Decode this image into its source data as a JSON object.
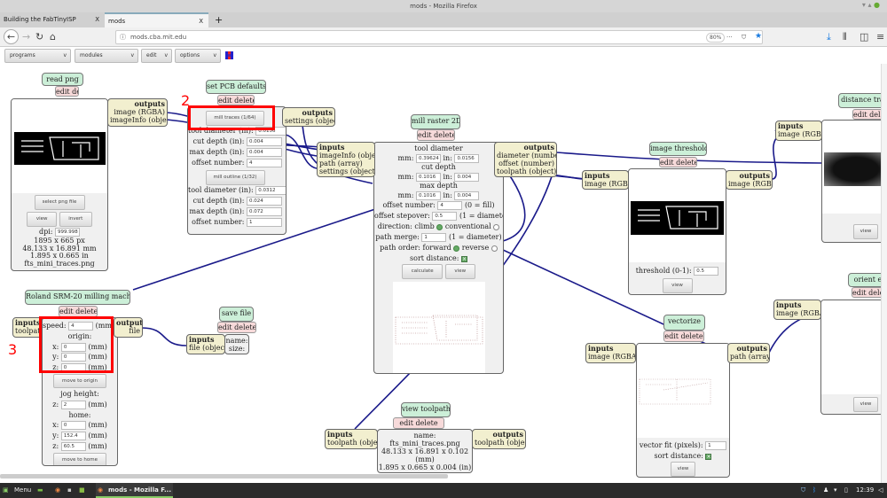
{
  "window": {
    "title": "mods - Mozilla Firefox"
  },
  "tabs": [
    {
      "label": "Building the FabTinyISP",
      "close": "X"
    },
    {
      "label": "mods",
      "close": "X"
    }
  ],
  "new_tab": "+",
  "nav": {
    "url": "mods.cba.mit.edu",
    "zoom": "80%",
    "more": "···"
  },
  "menus": [
    {
      "label": "programs"
    },
    {
      "label": "modules"
    },
    {
      "label": "edit"
    },
    {
      "label": "options"
    }
  ],
  "edit_delete": "edit delete",
  "annotations": {
    "n2": "2",
    "n3": "3"
  },
  "read_png": {
    "title": "read png",
    "outputs": "outputs",
    "out1": "image (RGBA)",
    "out2": "imageInfo (object)",
    "select": "select png file",
    "view": "view",
    "invert": "invert",
    "dpi_label": "dpi:",
    "dpi": "999.998",
    "px": "1895 x 665 px",
    "mm": "48.133 x 16.891 mm",
    "in": "1.895 x 0.665 in",
    "file": "fts_mini_traces.png"
  },
  "pcb": {
    "title": "set PCB defaults",
    "outputs": "outputs",
    "out1": "settings (object)",
    "traces": {
      "button": "mill traces (1/64)",
      "rows": [
        {
          "label": "tool diameter (in):",
          "value": "0.0156"
        },
        {
          "label": "cut depth (in):",
          "value": "0.004"
        },
        {
          "label": "max depth (in):",
          "value": "0.004"
        },
        {
          "label": "offset number:",
          "value": "4"
        }
      ]
    },
    "outline": {
      "button": "mill outline (1/32)",
      "rows": [
        {
          "label": "tool diameter (in):",
          "value": "0.0312"
        },
        {
          "label": "cut depth (in):",
          "value": "0.024"
        },
        {
          "label": "max depth (in):",
          "value": "0.072"
        },
        {
          "label": "offset number:",
          "value": "1"
        }
      ]
    }
  },
  "raster": {
    "title": "mill raster 2D",
    "inputs": "inputs",
    "in1": "imageInfo (object)",
    "in2": "path (array)",
    "in3": "settings (object)",
    "outputs": "outputs",
    "out1": "diameter (number)",
    "out2": "offset (number)",
    "out3": "toolpath (object)",
    "tool_diameter": "tool diameter",
    "td_mm": "0.39624",
    "td_in": "0.0156",
    "cut_depth": "cut depth",
    "cd_mm": "0.1016",
    "cd_in": "0.004",
    "max_depth": "max depth",
    "md_mm": "0.1016",
    "md_in": "0.004",
    "mm": "mm:",
    "in": "in:",
    "offset_number": "offset number:",
    "on_value": "4",
    "on_hint": "(0 = fill)",
    "stepover": "offset stepover:",
    "so_value": "0.5",
    "so_hint": "(1 = diameter)",
    "direction": "direction: climb",
    "conventional": "conventional",
    "merge": "path merge:",
    "merge_value": "1",
    "merge_hint": "(1 = diameter)",
    "order": "path order: forward",
    "reverse": "reverse",
    "sort": "sort distance:",
    "calculate": "calculate",
    "view": "view"
  },
  "threshold": {
    "title": "image threshold",
    "inputs": "inputs",
    "in1": "image (RGBA)",
    "outputs": "outputs",
    "out1": "image (RGBA)",
    "label": "threshold (0-1):",
    "value": "0.5",
    "view": "view"
  },
  "distance": {
    "title": "distance tran",
    "inputs": "inputs",
    "in1": "image (RGBA)",
    "view": "view"
  },
  "orient": {
    "title": "orient ed",
    "inputs": "inputs",
    "in1": "image (RGBA)",
    "view": "view"
  },
  "vectorize": {
    "title": "vectorize",
    "inputs": "inputs",
    "in1": "image (RGBA)",
    "outputs": "outputs",
    "out1": "path (array)",
    "fit": "vector fit (pixels):",
    "fit_value": "1",
    "sort": "sort distance:",
    "view": "view"
  },
  "viewtp": {
    "title": "view toolpath",
    "inputs": "inputs",
    "in1": "toolpath (object)",
    "outputs": "outputs",
    "out1": "toolpath (object)",
    "name": "name: fts_mini_traces.png",
    "mm": "48.133 x 16.891 x 0.102 (mm)",
    "in": "1.895 x 0.665 x 0.004 (in)",
    "view": "view"
  },
  "roland": {
    "title": "Roland SRM-20 milling machine",
    "inputs": "inputs",
    "in1": "toolpath",
    "outputs": "outputs",
    "out1": "file",
    "speed": "speed:",
    "speed_value": "4",
    "speed_unit": "(mm/s)",
    "origin": "origin:",
    "ox": "0",
    "oy": "0",
    "oz": "0",
    "unit": "(mm)",
    "x": "x:",
    "y": "y:",
    "z": "z:",
    "move_origin": "move to origin",
    "jog": "jog height:",
    "jz": "2",
    "home": "home:",
    "hx": "0",
    "hy": "152.4",
    "hz": "60.5",
    "move_home": "move to home"
  },
  "save": {
    "title": "save file",
    "inputs": "inputs",
    "in1": "file (object)",
    "name": "name:",
    "size": "size:"
  },
  "taskbar": {
    "menu": "Menu",
    "window": "mods - Mozilla F...",
    "clock": "12:39"
  },
  "colors": {
    "wire": "#1a1a8a",
    "title_bg": "#ccefd8",
    "edit_bg": "#f7dada",
    "io_bg": "#f2efcf",
    "highlight": "#ff0000"
  }
}
